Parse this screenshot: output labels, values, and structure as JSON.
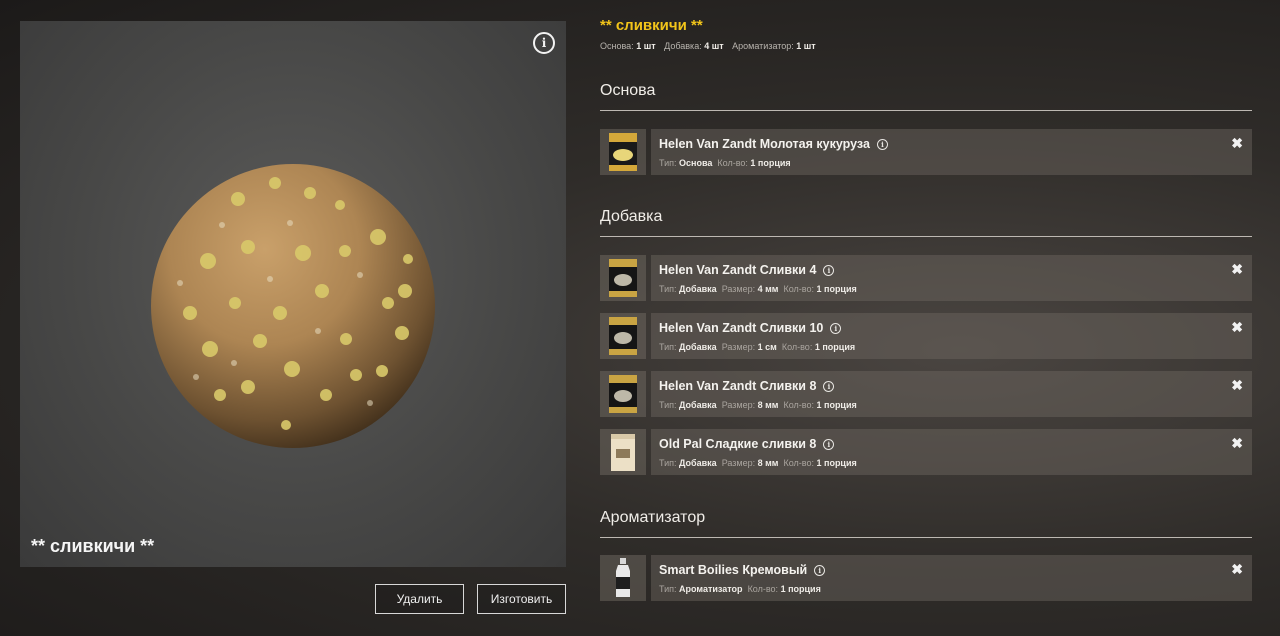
{
  "preview": {
    "name": "** сливкичи **",
    "info_icon": "i",
    "delete_label": "Удалить",
    "craft_label": "Изготовить"
  },
  "recipe": {
    "title": "** сливкичи **",
    "summary": [
      {
        "label": "Основа:",
        "value": "1 шт"
      },
      {
        "label": "Добавка:",
        "value": "4 шт"
      },
      {
        "label": "Ароматизатор:",
        "value": "1 шт"
      }
    ]
  },
  "sections": {
    "base": {
      "title": "Основа",
      "items": [
        {
          "name": "Helen Van Zandt Молотая кукуруза",
          "type_label": "Тип:",
          "type": "Основа",
          "qty_label": "Кол-во:",
          "qty": "1 порция",
          "thumb": "corn-bag-icon"
        }
      ]
    },
    "additive": {
      "title": "Добавка",
      "items": [
        {
          "name": "Helen Van Zandt Сливки 4",
          "type_label": "Тип:",
          "type": "Добавка",
          "size_label": "Размер:",
          "size": "4 мм",
          "qty_label": "Кол-во:",
          "qty": "1 порция",
          "thumb": "pellet-bag-icon"
        },
        {
          "name": "Helen Van Zandt Сливки 10",
          "type_label": "Тип:",
          "type": "Добавка",
          "size_label": "Размер:",
          "size": "1 см",
          "qty_label": "Кол-во:",
          "qty": "1 порция",
          "thumb": "pellet-bag-icon"
        },
        {
          "name": "Helen Van Zandt Сливки 8",
          "type_label": "Тип:",
          "type": "Добавка",
          "size_label": "Размер:",
          "size": "8 мм",
          "qty_label": "Кол-во:",
          "qty": "1 порция",
          "thumb": "pellet-bag-icon"
        },
        {
          "name": "Old Pal Сладкие сливки 8",
          "type_label": "Тип:",
          "type": "Добавка",
          "size_label": "Размер:",
          "size": "8 мм",
          "qty_label": "Кол-во:",
          "qty": "1 порция",
          "thumb": "paper-bag-icon"
        }
      ]
    },
    "flavor": {
      "title": "Ароматизатор",
      "items": [
        {
          "name": "Smart Boilies Кремовый",
          "type_label": "Тип:",
          "type": "Ароматизатор",
          "qty_label": "Кол-во:",
          "qty": "1 порция",
          "thumb": "bottle-icon"
        }
      ]
    }
  },
  "icons": {
    "remove": "✖",
    "info": "i"
  },
  "colors": {
    "accent": "#f2c51a"
  }
}
